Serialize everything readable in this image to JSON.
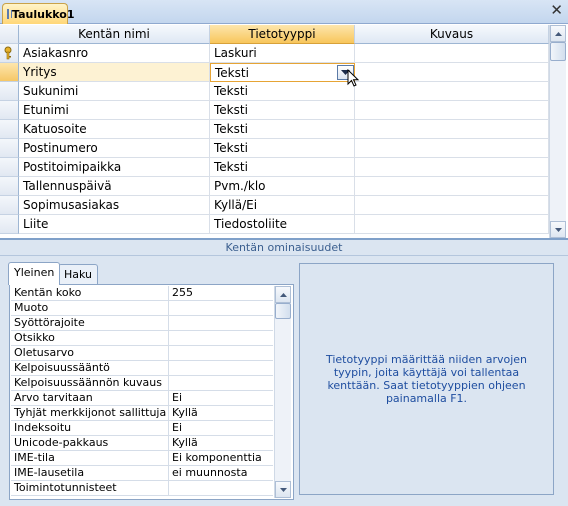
{
  "tab": {
    "title": "Taulukko1",
    "close": "✕"
  },
  "grid": {
    "headers": [
      "Kentän nimi",
      "Tietotyyppi",
      "Kuvaus"
    ],
    "rows": [
      {
        "name": "Asiakasnro",
        "type": "Laskuri",
        "desc": ""
      },
      {
        "name": "Yritys",
        "type": "Teksti",
        "desc": ""
      },
      {
        "name": "Sukunimi",
        "type": "Teksti",
        "desc": ""
      },
      {
        "name": "Etunimi",
        "type": "Teksti",
        "desc": ""
      },
      {
        "name": "Katuosoite",
        "type": "Teksti",
        "desc": ""
      },
      {
        "name": "Postinumero",
        "type": "Teksti",
        "desc": ""
      },
      {
        "name": "Postitoimipaikka",
        "type": "Teksti",
        "desc": ""
      },
      {
        "name": "Tallennuspäivä",
        "type": "Pvm./klo",
        "desc": ""
      },
      {
        "name": "Sopimusasiakas",
        "type": "Kyllä/Ei",
        "desc": ""
      },
      {
        "name": "Liite",
        "type": "Tiedostoliite",
        "desc": ""
      }
    ]
  },
  "properties": {
    "title": "Kentän ominaisuudet",
    "tabs": [
      "Yleinen",
      "Haku"
    ],
    "rows": [
      {
        "label": "Kentän koko",
        "value": "255"
      },
      {
        "label": "Muoto",
        "value": ""
      },
      {
        "label": "Syöttörajoite",
        "value": ""
      },
      {
        "label": "Otsikko",
        "value": ""
      },
      {
        "label": "Oletusarvo",
        "value": ""
      },
      {
        "label": "Kelpoisuussääntö",
        "value": ""
      },
      {
        "label": "Kelpoisuussäännön kuvaus",
        "value": ""
      },
      {
        "label": "Arvo tarvitaan",
        "value": "Ei"
      },
      {
        "label": "Tyhjät merkkijonot sallittuja",
        "value": "Kyllä"
      },
      {
        "label": "Indeksoitu",
        "value": "Ei"
      },
      {
        "label": "Unicode-pakkaus",
        "value": "Kyllä"
      },
      {
        "label": "IME-tila",
        "value": "Ei komponenttia"
      },
      {
        "label": "IME-lausetila",
        "value": "ei muunnosta"
      },
      {
        "label": "Toimintotunnisteet",
        "value": ""
      }
    ],
    "help": "Tietotyyppi määrittää niiden arvojen tyypin, joita käyttäjä voi tallentaa kenttään. Saat tietotyyppien ohjeen painamalla F1."
  }
}
